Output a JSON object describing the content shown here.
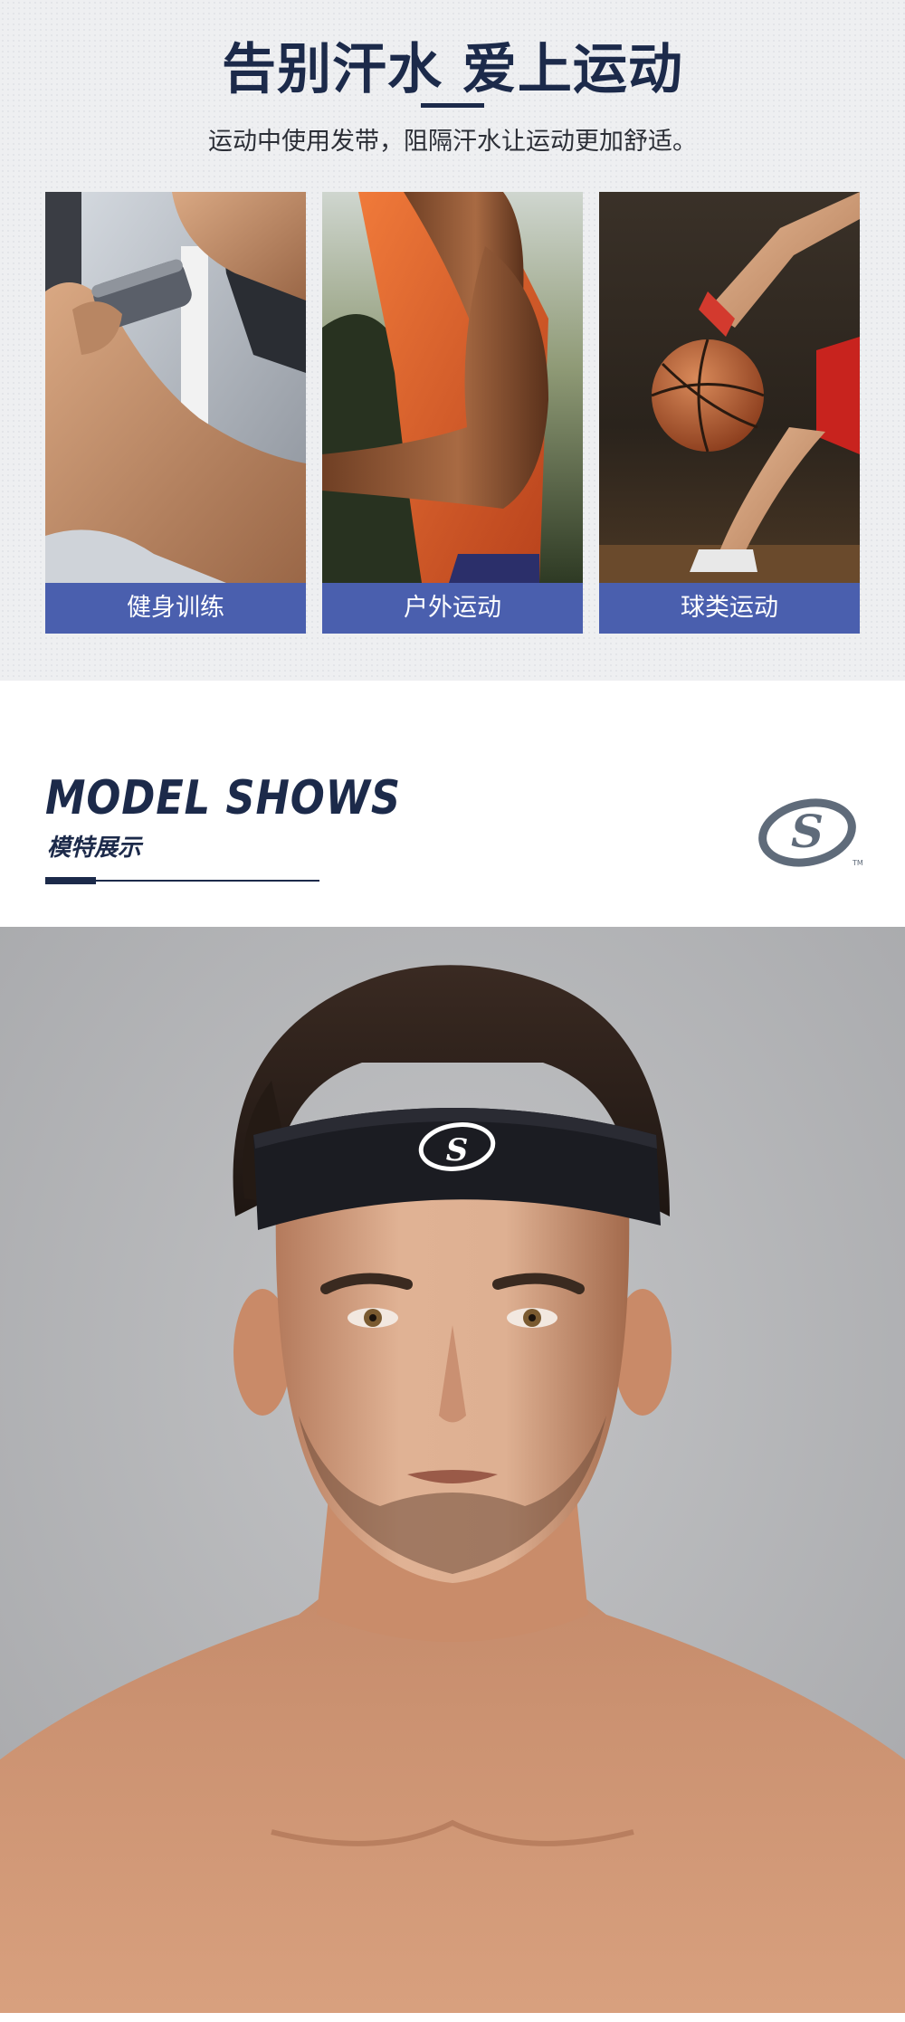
{
  "hero": {
    "title": "告别汗水 爱上运动",
    "subtitle": "运动中使用发带，阻隔汗水让运动更加舒适。",
    "cards": [
      {
        "label": "健身训练"
      },
      {
        "label": "户外运动"
      },
      {
        "label": "球类运动"
      }
    ]
  },
  "model_section": {
    "title": "MODEL SHOWS",
    "subtitle": "模特展示",
    "logo_tm": "TM"
  },
  "colors": {
    "navy": "#1c2a4a",
    "label_blue": "#4a5fae",
    "logo_gray": "#5f6b7a"
  }
}
